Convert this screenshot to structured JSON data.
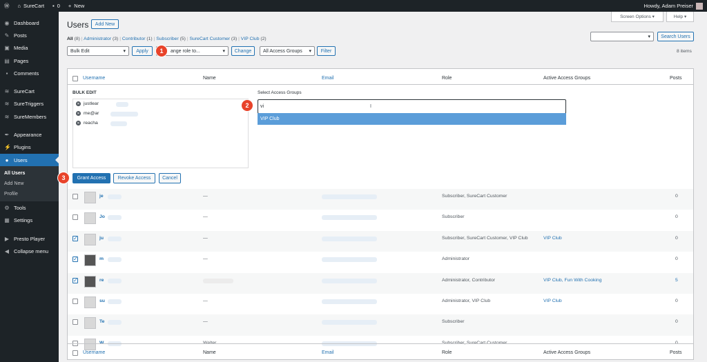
{
  "adminbar": {
    "site": "SureCart",
    "comments": "0",
    "new": "New",
    "howdy": "Howdy, Adam Preiser"
  },
  "sidebar": {
    "items": [
      {
        "label": "Dashboard",
        "icon": "dashboard-icon",
        "glyph": "◉"
      },
      {
        "label": "Posts",
        "icon": "pin-icon",
        "glyph": "✎"
      },
      {
        "label": "Media",
        "icon": "media-icon",
        "glyph": "▣"
      },
      {
        "label": "Pages",
        "icon": "pages-icon",
        "glyph": "▤"
      },
      {
        "label": "Comments",
        "icon": "comment-icon",
        "glyph": "▪"
      },
      {
        "label": "SureCart",
        "icon": "surecart-icon",
        "glyph": "≋"
      },
      {
        "label": "SureTriggers",
        "icon": "suretriggers-icon",
        "glyph": "≋"
      },
      {
        "label": "SureMembers",
        "icon": "suremembers-icon",
        "glyph": "≋"
      },
      {
        "label": "Appearance",
        "icon": "brush-icon",
        "glyph": "✒"
      },
      {
        "label": "Plugins",
        "icon": "plugin-icon",
        "glyph": "⚡"
      },
      {
        "label": "Users",
        "icon": "users-icon",
        "glyph": "●"
      },
      {
        "label": "Tools",
        "icon": "wrench-icon",
        "glyph": "⚙"
      },
      {
        "label": "Settings",
        "icon": "settings-icon",
        "glyph": "▦"
      },
      {
        "label": "Presto Player",
        "icon": "play-icon",
        "glyph": "▶"
      },
      {
        "label": "Collapse menu",
        "icon": "collapse-icon",
        "glyph": "◀"
      }
    ],
    "submenu": [
      "All Users",
      "Add New",
      "Profile"
    ]
  },
  "page": {
    "title": "Users",
    "add_new": "Add New",
    "screen_options": "Screen Options ▾",
    "help": "Help ▾",
    "search_button": "Search Users",
    "items_count": "8 items"
  },
  "filters": [
    {
      "label": "All",
      "count": "(8)"
    },
    {
      "label": "Administrator",
      "count": "(3)"
    },
    {
      "label": "Contributor",
      "count": "(1)"
    },
    {
      "label": "Subscriber",
      "count": "(5)"
    },
    {
      "label": "SureCart Customer",
      "count": "(3)"
    },
    {
      "label": "VIP Club",
      "count": "(2)"
    }
  ],
  "toolbar": {
    "bulk_edit": "Bulk Edit",
    "apply": "Apply",
    "change_role": "ange role to...",
    "change": "Change",
    "access_groups": "All Access Groups",
    "filter": "Filter"
  },
  "columns": {
    "username": "Username",
    "name": "Name",
    "email": "Email",
    "role": "Role",
    "groups": "Active Access Groups",
    "posts": "Posts"
  },
  "bulk": {
    "heading": "BULK EDIT",
    "users": [
      "justlear",
      "me@ar",
      "reacha"
    ],
    "select_label": "Select Access Groups",
    "search_value": "vi",
    "option": "VIP Club",
    "grant": "Grant Access",
    "revoke": "Revoke Access",
    "cancel": "Cancel"
  },
  "steps": [
    "1",
    "2",
    "3"
  ],
  "rows": [
    {
      "user": "je",
      "name": "—",
      "role": "Subscriber, SureCart Customer",
      "groups": "",
      "posts": "0",
      "checked": false
    },
    {
      "user": "Jo",
      "name": "—",
      "role": "Subscriber",
      "groups": "",
      "posts": "0",
      "checked": false
    },
    {
      "user": "ju",
      "name": "—",
      "role": "Subscriber, SureCart Customer, VIP Club",
      "groups": "VIP Club",
      "posts": "0",
      "checked": true
    },
    {
      "user": "m",
      "name": "—",
      "role": "Administrator",
      "groups": "",
      "posts": "0",
      "checked": true
    },
    {
      "user": "re",
      "name": "",
      "role": "Administrator, Contributor",
      "groups": "VIP Club, Fun With Cooking",
      "posts": "5",
      "checked": true
    },
    {
      "user": "su",
      "name": "—",
      "role": "Administrator, VIP Club",
      "groups": "VIP Club",
      "posts": "0",
      "checked": false
    },
    {
      "user": "Te",
      "name": "—",
      "role": "Subscriber",
      "groups": "",
      "posts": "0",
      "checked": false
    },
    {
      "user": "W",
      "name": "Walter",
      "role": "Subscriber, SureCart Customer",
      "groups": "",
      "posts": "0",
      "checked": false
    }
  ]
}
